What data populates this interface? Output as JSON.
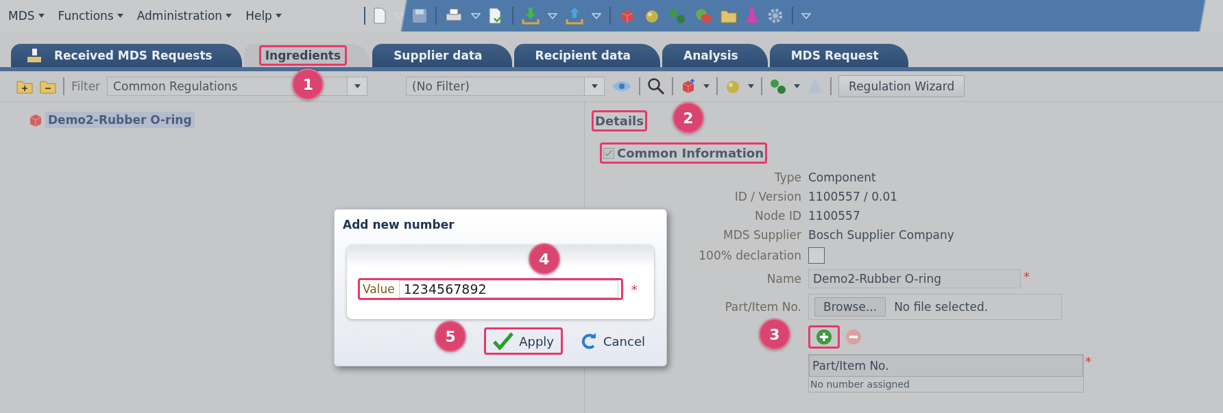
{
  "menu": [
    {
      "label": "MDS"
    },
    {
      "label": "Functions"
    },
    {
      "label": "Administration"
    },
    {
      "label": "Help"
    }
  ],
  "tabs": [
    {
      "label": "Received MDS Requests",
      "selected": false,
      "highlighted": false
    },
    {
      "label": "Ingredients",
      "selected": true,
      "highlighted": true,
      "callout": "1"
    },
    {
      "label": "Supplier data",
      "selected": false,
      "highlighted": false
    },
    {
      "label": "Recipient data",
      "selected": false,
      "highlighted": false
    },
    {
      "label": "Analysis",
      "selected": false,
      "highlighted": false
    },
    {
      "label": "MDS Request",
      "selected": false,
      "highlighted": false
    }
  ],
  "toolbar": {
    "filter_label": "Filter",
    "filter_value": "Common Regulations",
    "second_filter_value": "(No Filter)",
    "wizard_button": "Regulation Wizard"
  },
  "tree": [
    {
      "label": "Demo2-Rubber O-ring",
      "selected": true
    }
  ],
  "details": {
    "title": "Details",
    "highlighted": true,
    "callout": "2",
    "section": {
      "title": "Common Information",
      "expanded": true,
      "highlighted": true
    },
    "fields": [
      {
        "kind": "text",
        "label": "Type",
        "value": "Component"
      },
      {
        "kind": "text",
        "label": "ID / Version",
        "value": "1100557 / 0.01"
      },
      {
        "kind": "text",
        "label": "Node ID",
        "value": "1100557"
      },
      {
        "kind": "text",
        "label": "MDS Supplier",
        "value": "Bosch Supplier Company"
      },
      {
        "kind": "checkbox",
        "label": "100% declaration",
        "checked": false
      },
      {
        "kind": "input",
        "label": "Name",
        "value": "Demo2-Rubber O-ring",
        "required_mark": "*"
      },
      {
        "kind": "file",
        "label": "Part/Item No.",
        "button": "Browse...",
        "status": "No file selected."
      }
    ],
    "add_button": {
      "highlighted": true,
      "callout": "3"
    },
    "table": {
      "column": "Part/Item No.",
      "required_mark": "*",
      "empty_text": "No number assigned"
    }
  },
  "dialog": {
    "title": "Add new number",
    "field_label": "Value",
    "value": "1234567892",
    "required_mark": "*",
    "field_highlighted": true,
    "field_callout": "4",
    "apply": "Apply",
    "apply_highlighted": true,
    "apply_callout": "5",
    "cancel": "Cancel"
  }
}
